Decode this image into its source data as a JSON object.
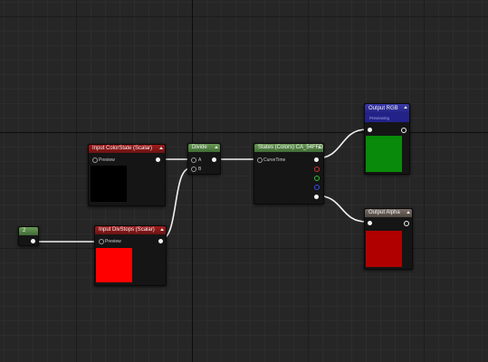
{
  "nodes": {
    "input_colorstate": {
      "title": "Input ColorState (Scalar)",
      "pin_label": "Preview",
      "swatch_color": "#000000"
    },
    "input_divstops": {
      "title": "Input DivStops (Scalar)",
      "pin_label": "Preview",
      "swatch_color": "#ff0000"
    },
    "constant": {
      "title": "2"
    },
    "divide": {
      "title": "Divide",
      "pin_a": "A",
      "pin_b": "B"
    },
    "curve": {
      "title": "States (Colors) CA_54FFD",
      "pin_label": "CurveTime"
    },
    "output_rgb": {
      "title": "Output RGB",
      "subtitle": "Previewing",
      "swatch_color": "#0a8a0a"
    },
    "output_alpha": {
      "title": "Output Alpha",
      "swatch_color": "#b00000"
    }
  },
  "colors": {
    "canvas_bg": "#262626",
    "wire": "#f2f2f2",
    "curve_pin_red": "#d03030",
    "curve_pin_green": "#30c030",
    "curve_pin_blue": "#3050e0"
  }
}
